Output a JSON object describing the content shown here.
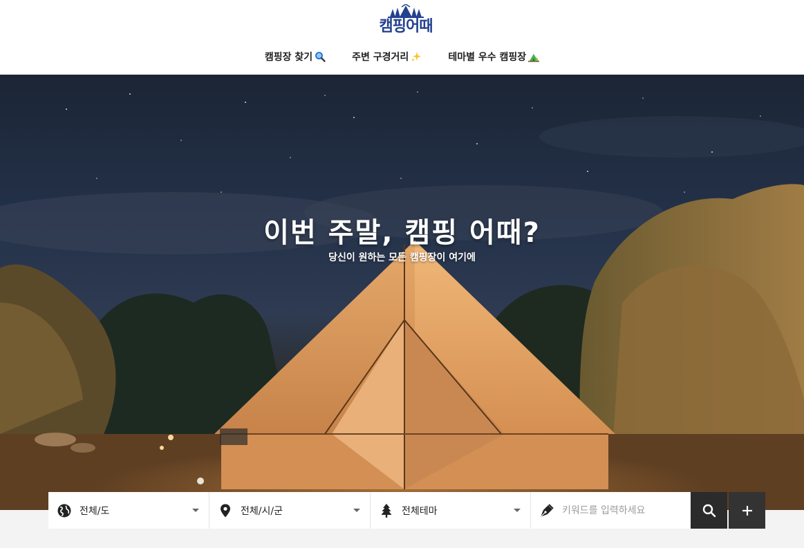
{
  "brand": {
    "logo_text": "캠핑어때",
    "logo_color": "#23418f"
  },
  "nav": {
    "items": [
      {
        "label": "캠핑장 찾기",
        "icon": "magnifier-emoji-icon"
      },
      {
        "label": "주변 구경거리",
        "icon": "sparkles-emoji-icon"
      },
      {
        "label": "테마별 우수 캠핑장",
        "icon": "camping-tent-emoji-icon"
      }
    ]
  },
  "hero": {
    "title": "이번 주말, 캠핑 어때?",
    "subtitle": "당신이 원하는 모든 캠핑장이 여기에"
  },
  "search": {
    "province_value": "전체/도",
    "city_value": "전체/시/군",
    "theme_value": "전체테마",
    "keyword_placeholder": "키워드를 입력하세요",
    "keyword_value": "",
    "icons": {
      "province": "globe-icon",
      "city": "map-pin-icon",
      "theme": "pine-tree-icon",
      "keyword": "pen-nib-icon",
      "search": "search-icon",
      "more": "plus-icon"
    }
  }
}
